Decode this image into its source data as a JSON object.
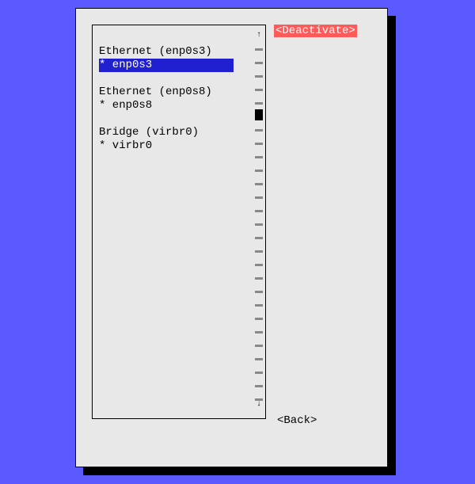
{
  "connections": [
    {
      "header": "Ethernet (enp0s3)",
      "name": "* enp0s3",
      "selected": true
    },
    {
      "header": "Ethernet (enp0s8)",
      "name": "* enp0s8",
      "selected": false
    },
    {
      "header": "Bridge (virbr0)",
      "name": "* virbr0",
      "selected": false
    }
  ],
  "buttons": {
    "deactivate": "<Deactivate>",
    "back": "<Back>"
  },
  "scroll": {
    "up_arrow": "↑",
    "down_arrow": "↓"
  }
}
